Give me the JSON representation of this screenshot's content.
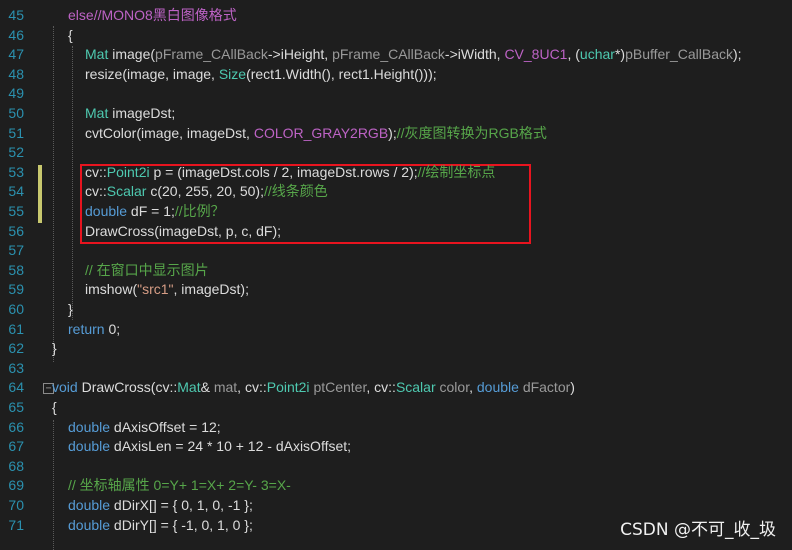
{
  "colors": {
    "background": "#1e1e1e",
    "line_number": "#2b91af",
    "keyword": "#569cd6",
    "type": "#4ec9b0",
    "comment": "#57a64a",
    "string": "#d69d85",
    "macro": "#bd63c5",
    "number": "#b5cea8",
    "param": "#9a9a9a",
    "plain": "#dcdcdc",
    "highlight_border": "#e8141f"
  },
  "lines": [
    {
      "num": "45",
      "tokens": [
        {
          "t": "else",
          "c": "macro"
        },
        {
          "t": "//MONO8黑白图像格式",
          "c": "macro"
        }
      ]
    },
    {
      "num": "46",
      "tokens": [
        {
          "t": "{",
          "c": "plain"
        }
      ]
    },
    {
      "num": "47",
      "tokens": [
        {
          "t": "Mat",
          "c": "type"
        },
        {
          "t": " image(",
          "c": "plain"
        },
        {
          "t": "pFrame_CAllBack",
          "c": "param"
        },
        {
          "t": "->",
          "c": "plain"
        },
        {
          "t": "iHeight",
          "c": "plain"
        },
        {
          "t": ", ",
          "c": "plain"
        },
        {
          "t": "pFrame_CAllBack",
          "c": "param"
        },
        {
          "t": "->",
          "c": "plain"
        },
        {
          "t": "iWidth",
          "c": "plain"
        },
        {
          "t": ", ",
          "c": "plain"
        },
        {
          "t": "CV_8UC1",
          "c": "macro"
        },
        {
          "t": ", (",
          "c": "plain"
        },
        {
          "t": "uchar",
          "c": "type"
        },
        {
          "t": "*)",
          "c": "plain"
        },
        {
          "t": "pBuffer_CallBack",
          "c": "param"
        },
        {
          "t": ");",
          "c": "plain"
        }
      ]
    },
    {
      "num": "48",
      "tokens": [
        {
          "t": "resize(image, image, ",
          "c": "plain"
        },
        {
          "t": "Size",
          "c": "type"
        },
        {
          "t": "(rect1.Width(), rect1.Height()));",
          "c": "plain"
        }
      ]
    },
    {
      "num": "49",
      "tokens": []
    },
    {
      "num": "50",
      "tokens": [
        {
          "t": "Mat",
          "c": "type"
        },
        {
          "t": " imageDst;",
          "c": "plain"
        }
      ]
    },
    {
      "num": "51",
      "tokens": [
        {
          "t": "cvtColor(image, imageDst, ",
          "c": "plain"
        },
        {
          "t": "COLOR_GRAY2RGB",
          "c": "macro"
        },
        {
          "t": ");",
          "c": "plain"
        },
        {
          "t": "//灰度图转换为RGB格式",
          "c": "comment"
        }
      ]
    },
    {
      "num": "52",
      "tokens": []
    },
    {
      "num": "53",
      "tokens": [
        {
          "t": "cv::",
          "c": "plain"
        },
        {
          "t": "Point2i",
          "c": "type"
        },
        {
          "t": " p = (imageDst.cols / 2, imageDst.rows / 2);",
          "c": "plain"
        },
        {
          "t": "//绘制坐标点",
          "c": "comment"
        }
      ]
    },
    {
      "num": "54",
      "tokens": [
        {
          "t": "cv::",
          "c": "plain"
        },
        {
          "t": "Scalar",
          "c": "type"
        },
        {
          "t": " c(20, 255, 20, 50);",
          "c": "plain"
        },
        {
          "t": "//线条颜色",
          "c": "comment"
        }
      ]
    },
    {
      "num": "55",
      "tokens": [
        {
          "t": "double",
          "c": "keyword"
        },
        {
          "t": " dF = 1;",
          "c": "plain"
        },
        {
          "t": "//比例？",
          "c": "comment"
        }
      ]
    },
    {
      "num": "56",
      "tokens": [
        {
          "t": "DrawCross(imageDst, p, c, dF);",
          "c": "plain"
        }
      ]
    },
    {
      "num": "57",
      "tokens": []
    },
    {
      "num": "58",
      "tokens": [
        {
          "t": "// 在窗口中显示图片",
          "c": "comment"
        }
      ]
    },
    {
      "num": "59",
      "tokens": [
        {
          "t": "imshow(",
          "c": "plain"
        },
        {
          "t": "\"src1\"",
          "c": "string"
        },
        {
          "t": ", imageDst);",
          "c": "plain"
        }
      ]
    },
    {
      "num": "60",
      "tokens": [
        {
          "t": "}",
          "c": "plain"
        }
      ]
    },
    {
      "num": "61",
      "tokens": [
        {
          "t": "return",
          "c": "keyword"
        },
        {
          "t": " 0;",
          "c": "plain"
        }
      ]
    },
    {
      "num": "62",
      "tokens": [
        {
          "t": "}",
          "c": "plain"
        }
      ]
    },
    {
      "num": "63",
      "tokens": []
    },
    {
      "num": "64",
      "tokens": [
        {
          "t": "void",
          "c": "keyword"
        },
        {
          "t": " DrawCross(cv::",
          "c": "plain"
        },
        {
          "t": "Mat",
          "c": "type"
        },
        {
          "t": "& ",
          "c": "plain"
        },
        {
          "t": "mat",
          "c": "param"
        },
        {
          "t": ", cv::",
          "c": "plain"
        },
        {
          "t": "Point2i",
          "c": "type"
        },
        {
          "t": " ",
          "c": "plain"
        },
        {
          "t": "ptCenter",
          "c": "param"
        },
        {
          "t": ", cv::",
          "c": "plain"
        },
        {
          "t": "Scalar",
          "c": "type"
        },
        {
          "t": " ",
          "c": "plain"
        },
        {
          "t": "color",
          "c": "param"
        },
        {
          "t": ", ",
          "c": "plain"
        },
        {
          "t": "double",
          "c": "keyword"
        },
        {
          "t": " ",
          "c": "plain"
        },
        {
          "t": "dFactor",
          "c": "param"
        },
        {
          "t": ")",
          "c": "plain"
        }
      ]
    },
    {
      "num": "65",
      "tokens": [
        {
          "t": "{",
          "c": "plain"
        }
      ]
    },
    {
      "num": "66",
      "tokens": [
        {
          "t": "double",
          "c": "keyword"
        },
        {
          "t": " dAxisOffset = 12;",
          "c": "plain"
        }
      ]
    },
    {
      "num": "67",
      "tokens": [
        {
          "t": "double",
          "c": "keyword"
        },
        {
          "t": " dAxisLen = 24 * 10 + 12 - dAxisOffset;",
          "c": "plain"
        }
      ]
    },
    {
      "num": "68",
      "tokens": []
    },
    {
      "num": "69",
      "tokens": [
        {
          "t": "// 坐标轴属性 0=Y+ 1=X+ 2=Y- 3=X-",
          "c": "comment"
        }
      ]
    },
    {
      "num": "70",
      "tokens": [
        {
          "t": "double",
          "c": "keyword"
        },
        {
          "t": " dDirX[] = { 0, 1, 0, -1 };",
          "c": "plain"
        }
      ]
    },
    {
      "num": "71",
      "tokens": [
        {
          "t": "double",
          "c": "keyword"
        },
        {
          "t": " dDirY[] = { -1, 0, 1, 0 };",
          "c": "plain"
        }
      ]
    }
  ],
  "collapse_markers": [
    "−",
    "−"
  ],
  "watermark": "CSDN @不可_收_圾"
}
